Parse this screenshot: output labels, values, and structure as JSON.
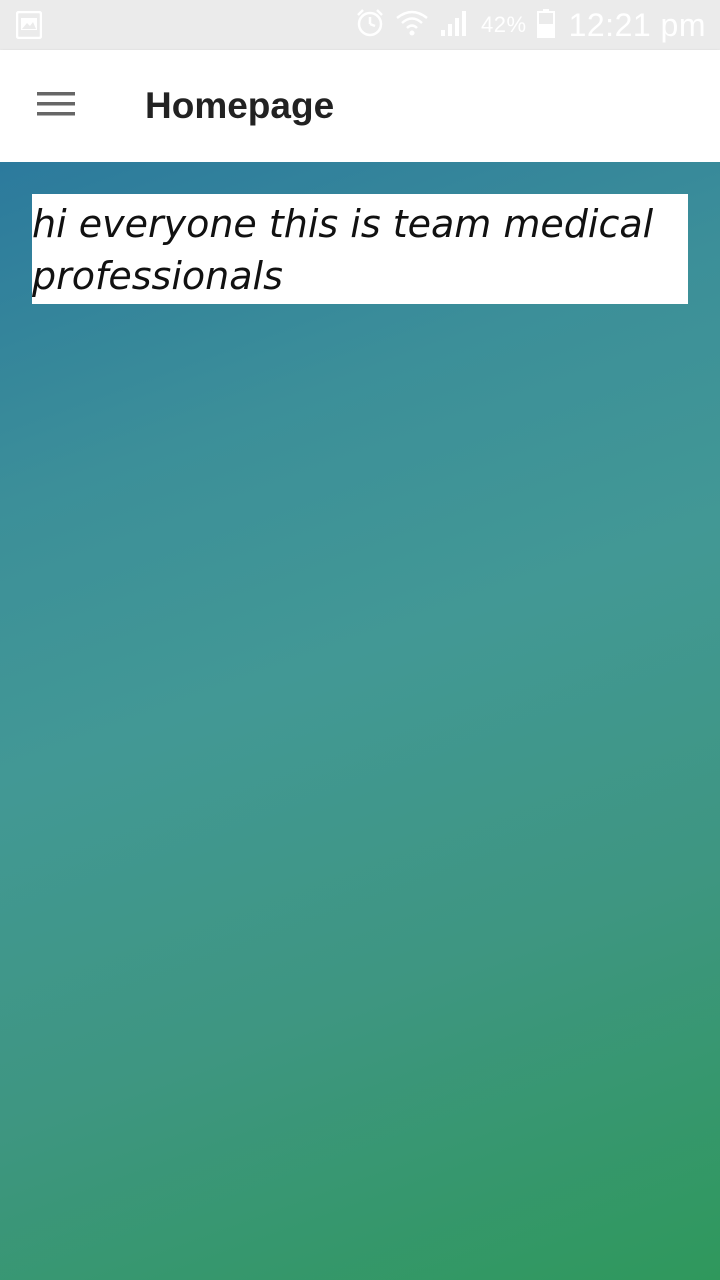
{
  "status_bar": {
    "battery_percent": "42%",
    "time": "12:21 pm",
    "icons": [
      "gallery-notification-icon",
      "alarm-icon",
      "wifi-icon",
      "signal-icon",
      "battery-icon"
    ]
  },
  "app_bar": {
    "title": "Homepage",
    "menu_icon": "hamburger-menu-icon"
  },
  "content": {
    "message": "hi everyone this is team medical professionals"
  },
  "colors": {
    "status_bar_bg": "#ebebeb",
    "app_bar_bg": "#ffffff",
    "gradient_top": "#2c7a9d",
    "gradient_bottom": "#2f985c",
    "message_bg": "#ffffff"
  }
}
